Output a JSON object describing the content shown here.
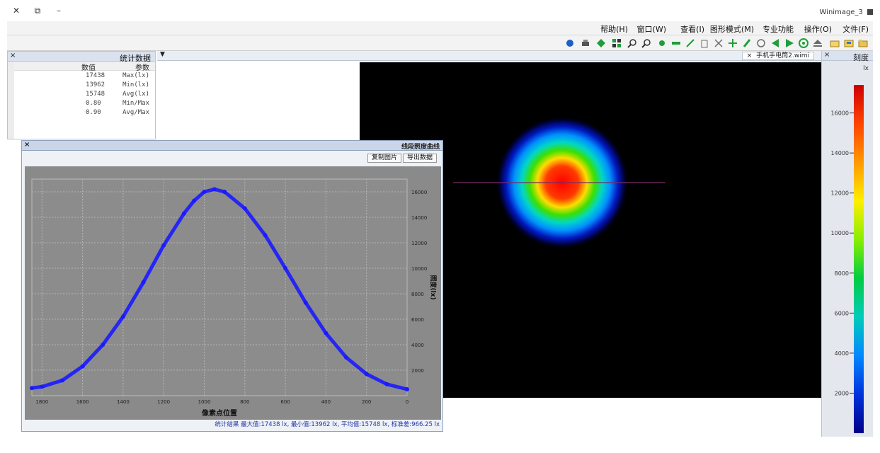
{
  "window": {
    "title": "Winimage_3",
    "close_label": "✕",
    "restore_label": "⧉",
    "minimize_label": "–"
  },
  "menu": [
    {
      "label": "文件(F)"
    },
    {
      "label": "操作(O)"
    },
    {
      "label": "专业功能"
    },
    {
      "label": "图形模式(M)"
    },
    {
      "label": "查看(I)"
    },
    {
      "label": "窗口(W)"
    },
    {
      "label": "帮助(H)"
    }
  ],
  "toolbar": {
    "icons": [
      "open-icon",
      "save-icon",
      "folder-icon",
      "eject-icon",
      "target-icon",
      "play-icon",
      "step-back-icon",
      "circle-icon",
      "pen-icon",
      "crosshair-icon",
      "close-icon",
      "delete-icon",
      "line-icon",
      "bar-icon",
      "dot-icon",
      "zoom-in-icon",
      "zoom-out-icon",
      "palette-icon",
      "diamond-icon",
      "print-icon",
      "info-icon"
    ],
    "colors": {
      "green": "#1f9e3a",
      "blue": "#1d5fc4",
      "gray": "#6b6b6b"
    }
  },
  "stats_panel": {
    "title": "统计数据",
    "col_param": "参数",
    "col_value": "数值",
    "rows": [
      {
        "param": "Max(lx)",
        "value": "17438"
      },
      {
        "param": "Min(lx)",
        "value": "13962"
      },
      {
        "param": "Avg(lx)",
        "value": "15748"
      },
      {
        "param": "Min/Max",
        "value": "0.80"
      },
      {
        "param": "Avg/Max",
        "value": "0.90"
      }
    ]
  },
  "image_view": {
    "tab_label": "手机手电筒2.wimi",
    "tab_close": "×",
    "overlay_line_color": "#7a2a6a",
    "panel_close": "×"
  },
  "scale_panel": {
    "title": "刻度",
    "unit": "lx",
    "ticks": [
      "16000",
      "14000",
      "12000",
      "10000",
      "8000",
      "6000",
      "4000",
      "2000"
    ],
    "colormap": [
      "#cc0000",
      "#ff4400",
      "#ff9900",
      "#ffee00",
      "#88ee00",
      "#00cc44",
      "#00ccbb",
      "#0088ff",
      "#0033dd",
      "#000088"
    ]
  },
  "profile_dialog": {
    "title": "线段照度曲线",
    "close": "×",
    "export_label": "导出数据",
    "copy_label": "复制图片",
    "x_axis_label": "像素点位置",
    "y_axis_label": "照度(lx)",
    "status": "统计结果   最大值:17438 lx, 最小值:13962 lx, 平均值:15748 lx, 标准差:966.25 lx"
  },
  "chart_data": {
    "type": "scatter",
    "title": "",
    "xlabel": "像素点位置",
    "ylabel": "照度(lx)",
    "xlim": [
      0,
      1850
    ],
    "ylim": [
      0,
      17000
    ],
    "x_ticks": [
      0,
      200,
      400,
      600,
      800,
      1000,
      1200,
      1400,
      1600,
      1800
    ],
    "y_ticks": [
      2000,
      4000,
      6000,
      8000,
      10000,
      12000,
      14000,
      16000
    ],
    "grid": true,
    "series": [
      {
        "color": "#1a1aff",
        "x": [
          0,
          100,
          200,
          300,
          400,
          500,
          600,
          700,
          800,
          900,
          950,
          1000,
          1050,
          1100,
          1200,
          1300,
          1400,
          1500,
          1600,
          1700,
          1800,
          1850
        ],
        "y": [
          500,
          900,
          1700,
          3000,
          4900,
          7300,
          10000,
          12600,
          14700,
          16000,
          16200,
          16000,
          15300,
          14300,
          11800,
          8900,
          6200,
          4000,
          2300,
          1200,
          700,
          600
        ]
      }
    ]
  }
}
